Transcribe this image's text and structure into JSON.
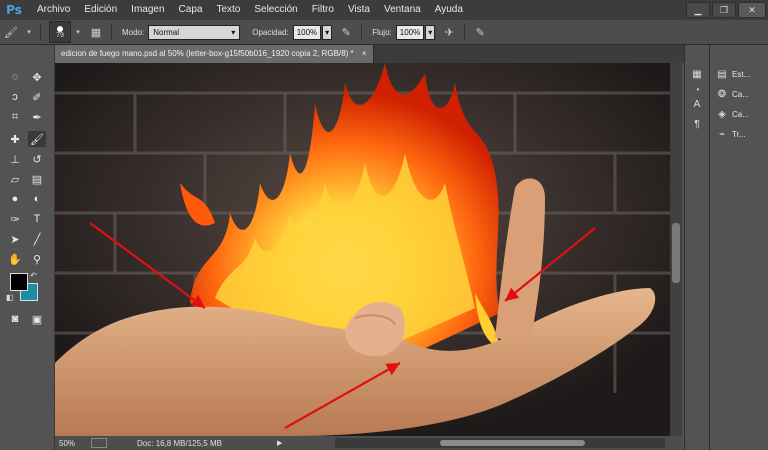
{
  "app": {
    "logo": "Ps"
  },
  "menu": [
    "Archivo",
    "Edición",
    "Imagen",
    "Capa",
    "Texto",
    "Selección",
    "Filtro",
    "Vista",
    "Ventana",
    "Ayuda"
  ],
  "options": {
    "brush_size": "79",
    "mode_label": "Modo:",
    "mode_value": "Normal",
    "opacity_label": "Opacidad:",
    "opacity_value": "100%",
    "flow_label": "Flujo:",
    "flow_value": "100%"
  },
  "document": {
    "tab_title": "edicion de fuego mano.psd al 50% (letter-box-g15f50b016_1920 copia 2, RGB/8) *",
    "close_glyph": "×"
  },
  "status": {
    "zoom": "50%",
    "doc_info": "Doc: 16,8 MB/125,5 MB"
  },
  "right_panels": [
    {
      "icon": "paragraph-styles-icon",
      "label": "Est..."
    },
    {
      "icon": "channels-icon",
      "label": "Ca..."
    },
    {
      "icon": "layers-icon",
      "label": "Ca..."
    },
    {
      "icon": "paths-icon",
      "label": "Tr..."
    }
  ],
  "colors": {
    "foreground": "#000000",
    "background": "#1b8ea1",
    "annotation_arrows": "#e01010"
  }
}
